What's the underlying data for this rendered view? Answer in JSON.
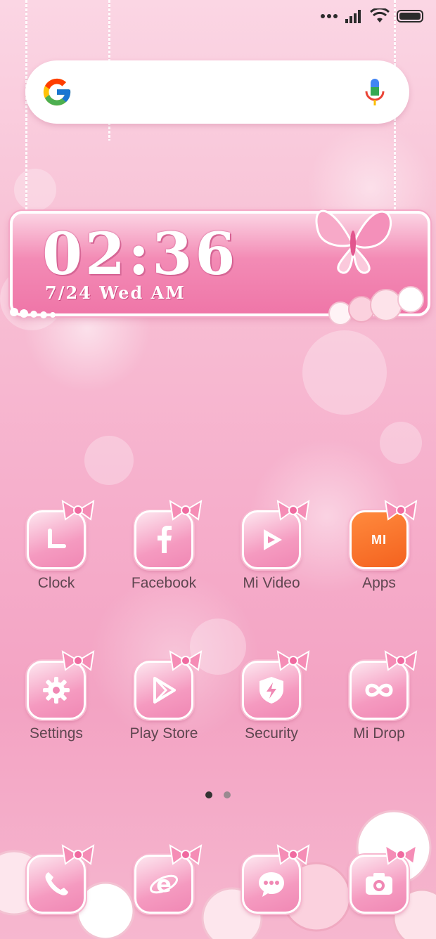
{
  "status_bar": {
    "signal_icon": "signal-icon",
    "wifi_icon": "wifi-icon",
    "battery_icon": "battery-icon"
  },
  "search": {
    "logo_icon": "google-logo-icon",
    "mic_icon": "mic-icon"
  },
  "clock_widget": {
    "time": "02:36",
    "date": "7/24 Wed  AM"
  },
  "apps_row1": [
    {
      "label": "Clock",
      "icon": "clock-icon"
    },
    {
      "label": "Facebook",
      "icon": "facebook-icon"
    },
    {
      "label": "Mi Video",
      "icon": "play-video-icon"
    },
    {
      "label": "Apps",
      "icon": "mi-apps-icon",
      "badge_text": "MI"
    }
  ],
  "apps_row2": [
    {
      "label": "Settings",
      "icon": "gear-icon"
    },
    {
      "label": "Play Store",
      "icon": "play-store-icon"
    },
    {
      "label": "Security",
      "icon": "shield-icon"
    },
    {
      "label": "Mi Drop",
      "icon": "infinity-icon"
    }
  ],
  "dock": [
    {
      "icon": "phone-icon"
    },
    {
      "icon": "browser-icon"
    },
    {
      "icon": "messages-icon"
    },
    {
      "icon": "camera-icon"
    }
  ],
  "page_indicator": {
    "pages": 2,
    "active": 1,
    "active_color": "#333333",
    "inactive_color": "#9a8a90"
  },
  "colors": {
    "accent_pink": "#f088b4",
    "mi_orange": "#f4621f"
  }
}
